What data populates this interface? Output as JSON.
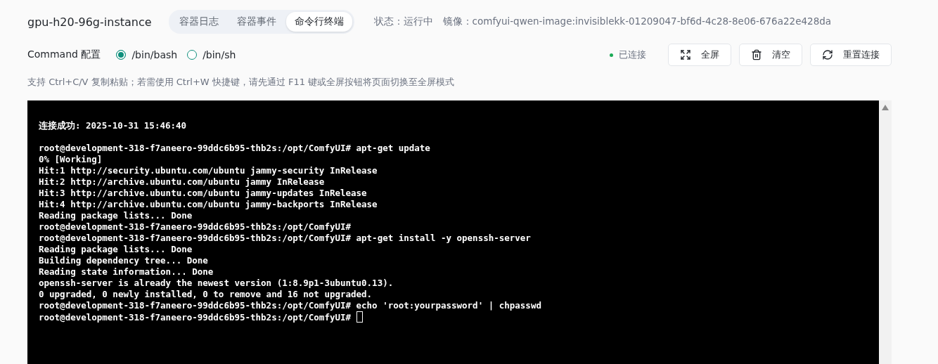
{
  "instance_title": "gpu-h20-96g-instance",
  "tabs": [
    {
      "label": "容器日志",
      "selected": false
    },
    {
      "label": "容器事件",
      "selected": false
    },
    {
      "label": "命令行终端",
      "selected": true
    }
  ],
  "status": "状态：运行中",
  "image": "镜像：comfyui-qwen-image:invisiblekk-01209047-bf6d-4c28-8e06-676a22e428da",
  "command_label": "Command 配置",
  "shells": [
    {
      "label": "/bin/bash",
      "selected": true
    },
    {
      "label": "/bin/sh",
      "selected": false
    }
  ],
  "connection": {
    "label": "已连接",
    "connected": true
  },
  "buttons": [
    {
      "kind": "fullscreen",
      "label": "全屏"
    },
    {
      "kind": "clear",
      "label": "清空"
    },
    {
      "kind": "reconnect",
      "label": "重置连接"
    }
  ],
  "hint": "支持 Ctrl+C/V 复制粘贴；若需使用 Ctrl+W 快捷键，请先通过 F11 键或全屏按钮将页面切换至全屏模式",
  "terminal": {
    "header": "连接成功: 2025-10-31 15:46:40",
    "cursor": true,
    "lines": [
      "root@development-318-f7aneero-99ddc6b95-thb2s:/opt/ComfyUI# apt-get update",
      "0% [Working]",
      "Hit:1 http://security.ubuntu.com/ubuntu jammy-security InRelease",
      "Hit:2 http://archive.ubuntu.com/ubuntu jammy InRelease",
      "Hit:3 http://archive.ubuntu.com/ubuntu jammy-updates InRelease",
      "Hit:4 http://archive.ubuntu.com/ubuntu jammy-backports InRelease",
      "Reading package lists... Done",
      "root@development-318-f7aneero-99ddc6b95-thb2s:/opt/ComfyUI#",
      "root@development-318-f7aneero-99ddc6b95-thb2s:/opt/ComfyUI# apt-get install -y openssh-server",
      "Reading package lists... Done",
      "Building dependency tree... Done",
      "Reading state information... Done",
      "openssh-server is already the newest version (1:8.9p1-3ubuntu0.13).",
      "0 upgraded, 0 newly installed, 0 to remove and 16 not upgraded.",
      "root@development-318-f7aneero-99ddc6b95-thb2s:/opt/ComfyUI# echo 'root:yourpassword' | chpasswd",
      "root@development-318-f7aneero-99ddc6b95-thb2s:/opt/ComfyUI#"
    ]
  }
}
